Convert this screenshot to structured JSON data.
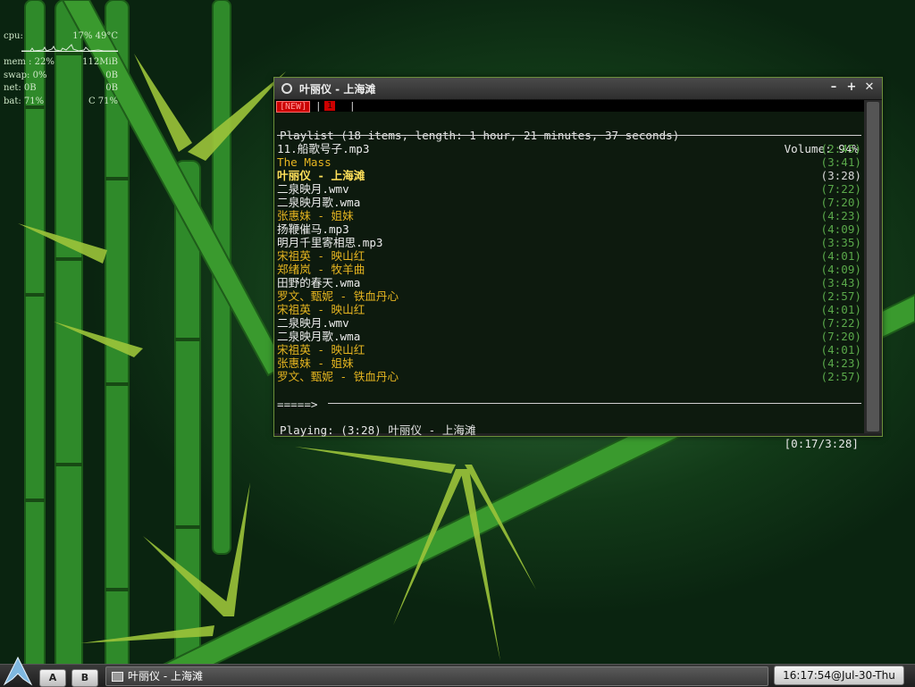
{
  "conky": {
    "cpu_label": "cpu:",
    "cpu_value": "17% 49°C",
    "mem_label": "mem : 22%",
    "mem_value": "112MiB",
    "swap_label": "swap: 0%",
    "swap_value": "0B",
    "net_label": "net: 0B",
    "net_value": "0B",
    "bat_label": "bat: 71%",
    "bat_value": "C 71%"
  },
  "window": {
    "title": "叶丽仪 - 上海滩",
    "controls": {
      "minimize": "–",
      "maximize": "+",
      "close": "✕"
    }
  },
  "terminal": {
    "tabs": {
      "new": "[NEW]",
      "one": "1"
    },
    "header": {
      "playlist": "Playlist (18 items, length: 1 hour, 21 minutes, 37 seconds)",
      "volume": "Volume: 94%"
    },
    "items": [
      {
        "name": "11.船歌号子.mp3",
        "duration": "(2:45)",
        "style": "white"
      },
      {
        "name": "The Mass",
        "duration": "(3:41)",
        "style": "yellow"
      },
      {
        "name": "叶丽仪 - 上海滩",
        "duration": "(3:28)",
        "style": "current"
      },
      {
        "name": "二泉映月.wmv",
        "duration": "(7:22)",
        "style": "white"
      },
      {
        "name": "二泉映月歌.wma",
        "duration": "(7:20)",
        "style": "white"
      },
      {
        "name": "张惠妹 - 姐妹",
        "duration": "(4:23)",
        "style": "yellow"
      },
      {
        "name": "扬鞭催马.mp3",
        "duration": "(4:09)",
        "style": "white"
      },
      {
        "name": "明月千里寄相思.mp3",
        "duration": "(3:35)",
        "style": "white"
      },
      {
        "name": "宋祖英 - 映山红",
        "duration": "(4:01)",
        "style": "yellow"
      },
      {
        "name": "郑绪岚 - 牧羊曲",
        "duration": "(4:09)",
        "style": "yellow"
      },
      {
        "name": "田野的春天.wma",
        "duration": "(3:43)",
        "style": "white"
      },
      {
        "name": "罗文、甄妮 - 铁血丹心",
        "duration": "(2:57)",
        "style": "yellow"
      },
      {
        "name": "宋祖英 - 映山红",
        "duration": "(4:01)",
        "style": "yellow"
      },
      {
        "name": "二泉映月.wmv",
        "duration": "(7:22)",
        "style": "white"
      },
      {
        "name": "二泉映月歌.wma",
        "duration": "(7:20)",
        "style": "white"
      },
      {
        "name": "宋祖英 - 映山红",
        "duration": "(4:01)",
        "style": "yellow"
      },
      {
        "name": "张惠妹 - 姐妹",
        "duration": "(4:23)",
        "style": "yellow"
      },
      {
        "name": "罗文、甄妮 - 铁血丹心",
        "duration": "(2:57)",
        "style": "yellow"
      }
    ],
    "progress_bar": "=====>",
    "status": {
      "playing": "Playing: (3:28) 叶丽仪 - 上海滩",
      "position": "[0:17/3:28]"
    }
  },
  "taskbar": {
    "workspace_a": "A",
    "workspace_b": "B",
    "task_label": "叶丽仪 - 上海滩",
    "clock": "16:17:54@Jul-30-Thu"
  },
  "colors": {
    "playlist_white": "#ececec",
    "playlist_yellow": "#e6b520",
    "current_track": "#ffe05a",
    "duration_green": "#5aa84a",
    "tab_red": "#cc0000"
  }
}
